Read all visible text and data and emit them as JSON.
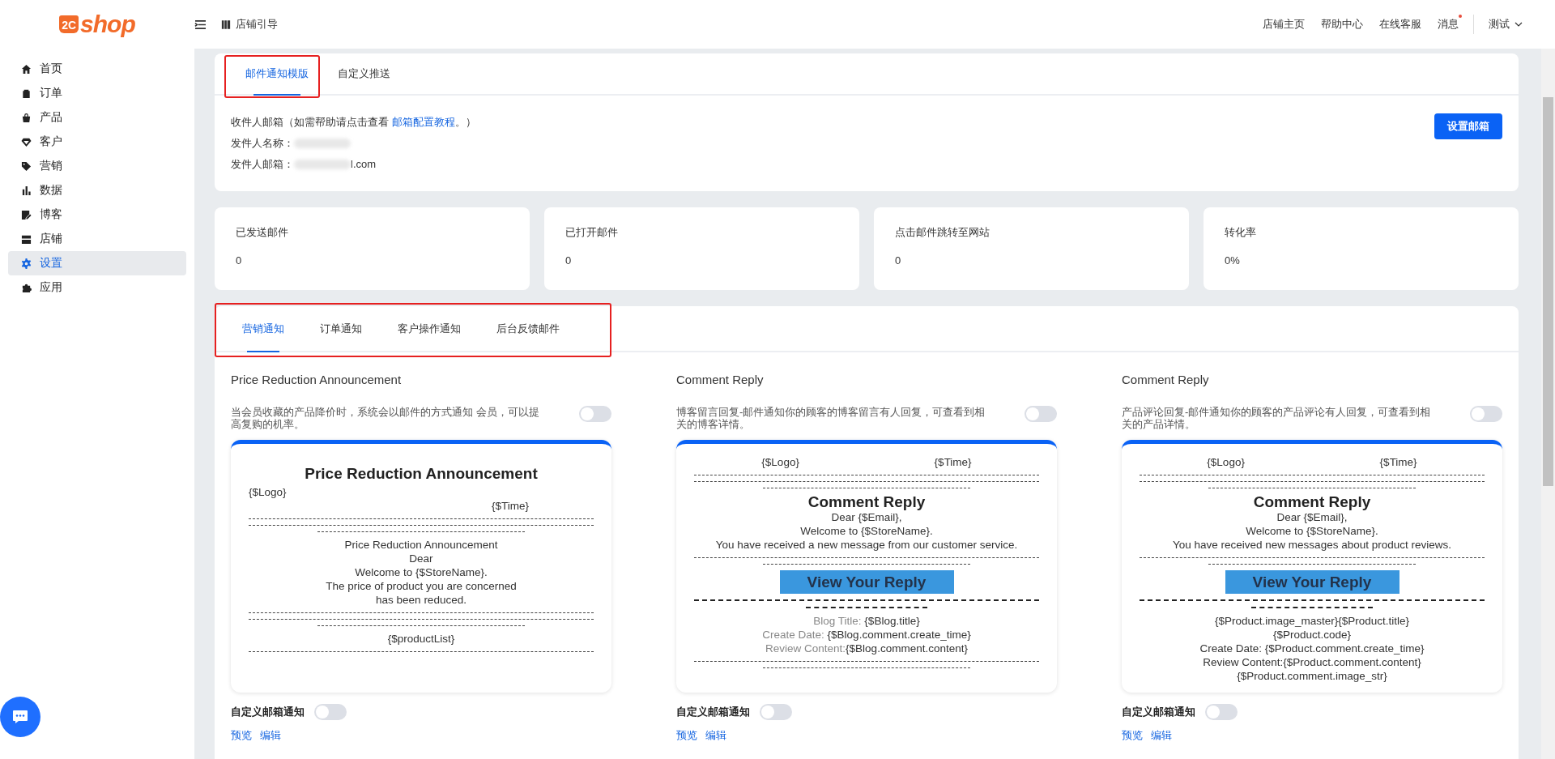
{
  "header": {
    "logo_mark": "2C",
    "logo_text": "shop",
    "guide": "店铺引导",
    "links": [
      "店铺主页",
      "帮助中心",
      "在线客服"
    ],
    "messages": {
      "label": "消息",
      "unread": true
    },
    "user": "测试"
  },
  "sidebar": {
    "items": [
      {
        "label": "首页",
        "selected": false
      },
      {
        "label": "订单",
        "selected": false
      },
      {
        "label": "产品",
        "selected": false
      },
      {
        "label": "客户",
        "selected": false
      },
      {
        "label": "营销",
        "selected": false
      },
      {
        "label": "数据",
        "selected": false
      },
      {
        "label": "博客",
        "selected": false
      },
      {
        "label": "店铺",
        "selected": false
      },
      {
        "label": "设置",
        "selected": true
      },
      {
        "label": "应用",
        "selected": false
      }
    ]
  },
  "top_tabs": [
    {
      "label": "邮件通知模版",
      "selected": true,
      "highlighted": true
    },
    {
      "label": "自定义推送",
      "selected": false,
      "highlighted": false
    }
  ],
  "mail_info": {
    "receiver_label": "收件人邮箱（如需帮助请点击查看 ",
    "receiver_link": "邮箱配置教程",
    "receiver_end": "。）",
    "sender_name_label": "发件人名称：",
    "sender_email_label": "发件人邮箱：",
    "sender_email_tail": "l.com",
    "button": "设置邮箱"
  },
  "stats": [
    {
      "label": "已发送邮件",
      "value": "0"
    },
    {
      "label": "已打开邮件",
      "value": "0"
    },
    {
      "label": "点击邮件跳转至网站",
      "value": "0"
    },
    {
      "label": "转化率",
      "value": "0%"
    }
  ],
  "notice_tabs": {
    "highlighted": true,
    "tabs": [
      {
        "label": "营销通知",
        "selected": true
      },
      {
        "label": "订单通知",
        "selected": false
      },
      {
        "label": "客户操作通知",
        "selected": false
      },
      {
        "label": "后台反馈邮件",
        "selected": false
      }
    ]
  },
  "templates": [
    {
      "title": "Price Reduction Announcement",
      "description": "当会员收藏的产品降价时，系统会以邮件的方式通知 会员，可以提高复购的机率。",
      "enabled": false,
      "custom_label": "自定义邮箱通知",
      "custom_enabled": false,
      "actions": [
        "预览",
        "编辑"
      ],
      "preview": [
        {
          "kind": "heading",
          "text": "Price Reduction Announcement"
        },
        {
          "kind": "logo-time-stacked",
          "logo": "{$Logo}",
          "time": "{$Time}"
        },
        {
          "kind": "rule"
        },
        {
          "kind": "rule"
        },
        {
          "kind": "short-rule"
        },
        {
          "kind": "text",
          "text": "Price Reduction Announcement"
        },
        {
          "kind": "text",
          "text": "Dear"
        },
        {
          "kind": "text",
          "text": "Welcome to {$StoreName}."
        },
        {
          "kind": "text",
          "text": "The price of product you are concerned"
        },
        {
          "kind": "text",
          "text": "has been reduced."
        },
        {
          "kind": "rule"
        },
        {
          "kind": "rule"
        },
        {
          "kind": "short-rule"
        },
        {
          "kind": "text",
          "text": "{$productList}"
        },
        {
          "kind": "rule"
        }
      ]
    },
    {
      "title": "Comment Reply",
      "description": "博客留言回复-邮件通知你的顾客的博客留言有人回复，可查看到相关的博客详情。",
      "enabled": false,
      "custom_label": "自定义邮箱通知",
      "custom_enabled": false,
      "actions": [
        "预览",
        "编辑"
      ],
      "preview": [
        {
          "kind": "logo-time",
          "logo": "{$Logo}",
          "time": "{$Time}"
        },
        {
          "kind": "rule"
        },
        {
          "kind": "rule"
        },
        {
          "kind": "short-rule"
        },
        {
          "kind": "subheading",
          "text": "Comment Reply"
        },
        {
          "kind": "text",
          "text": "Dear {$Email},"
        },
        {
          "kind": "text",
          "text": "Welcome to {$StoreName}."
        },
        {
          "kind": "text",
          "text": "You have received a new message from our customer service."
        },
        {
          "kind": "rule"
        },
        {
          "kind": "short-rule"
        },
        {
          "kind": "cta",
          "text": "View Your Reply"
        },
        {
          "kind": "thick-rule"
        },
        {
          "kind": "short-thick-rule"
        },
        {
          "kind": "field",
          "label": "Blog Title:",
          "value": " {$Blog.title}"
        },
        {
          "kind": "field",
          "label": "Create Date:",
          "value": " {$Blog.comment.create_time}"
        },
        {
          "kind": "field",
          "label": "Review Content:",
          "value": "{$Blog.comment.content}"
        },
        {
          "kind": "rule"
        },
        {
          "kind": "short-rule"
        }
      ]
    },
    {
      "title": "Comment Reply",
      "description": "产品评论回复-邮件通知你的顾客的产品评论有人回复，可查看到相关的产品详情。",
      "enabled": false,
      "custom_label": "自定义邮箱通知",
      "custom_enabled": false,
      "actions": [
        "预览",
        "编辑"
      ],
      "preview": [
        {
          "kind": "logo-time",
          "logo": "{$Logo}",
          "time": "{$Time}"
        },
        {
          "kind": "rule"
        },
        {
          "kind": "rule"
        },
        {
          "kind": "short-rule"
        },
        {
          "kind": "subheading",
          "text": "Comment Reply"
        },
        {
          "kind": "text",
          "text": "Dear {$Email},"
        },
        {
          "kind": "text",
          "text": "Welcome to {$StoreName}."
        },
        {
          "kind": "text",
          "text": "You have received new messages about product reviews."
        },
        {
          "kind": "rule"
        },
        {
          "kind": "short-rule"
        },
        {
          "kind": "cta",
          "text": "View Your Reply"
        },
        {
          "kind": "thick-rule"
        },
        {
          "kind": "short-thick-rule"
        },
        {
          "kind": "text",
          "text": "{$Product.image_master}{$Product.title}"
        },
        {
          "kind": "text",
          "text": "{$Product.code}"
        },
        {
          "kind": "text",
          "text": "Create Date: {$Product.comment.create_time}"
        },
        {
          "kind": "text",
          "text": "Review Content:{$Product.comment.content}"
        },
        {
          "kind": "text",
          "text": "{$Product.comment.image_str}"
        }
      ]
    }
  ]
}
